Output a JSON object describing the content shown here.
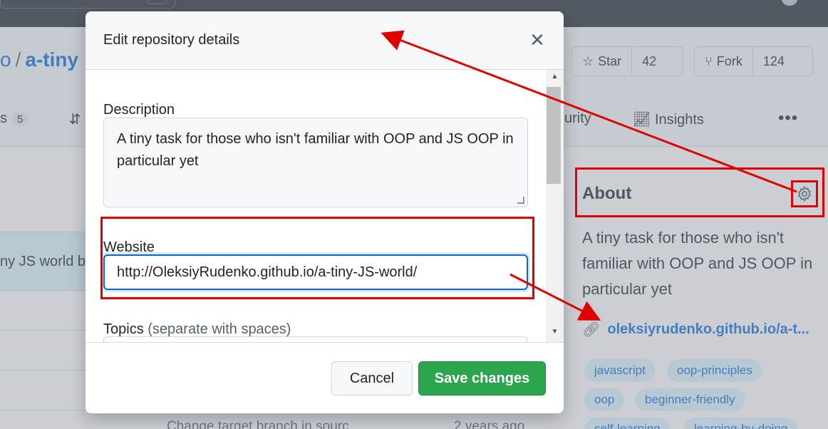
{
  "repo": {
    "owner": "o",
    "name": "a-tiny",
    "star_label": "Star",
    "star_count": "42",
    "fork_label": "Fork",
    "fork_count": "124"
  },
  "tabs": {
    "issues_suffix": "s",
    "issues_count": "5",
    "security_label": "urity",
    "insights_label": "Insights",
    "more_label": "•••"
  },
  "files": {
    "highlighted_row_text": "ny JS world b",
    "commit_snippet": "Change target branch in sourc",
    "ago_snippet": "2 years ago"
  },
  "about": {
    "title": "About",
    "description": "A tiny task for those who isn't familiar with OOP and JS OOP in particular yet",
    "link": "oleksiyrudenko.github.io/a-t...",
    "topics": [
      "javascript",
      "oop-principles",
      "oop",
      "beginner-friendly",
      "self-learning",
      "learning-by-doing"
    ]
  },
  "modal": {
    "title": "Edit repository details",
    "close_glyph": "✕",
    "description_label": "Description",
    "description_value": "A tiny task for those who isn't familiar with OOP and JS OOP in particular yet",
    "website_label": "Website",
    "website_value": "http://OleksiyRudenko.github.io/a-tiny-JS-world/",
    "topics_label": "Topics",
    "topics_hint": "(separate with spaces)",
    "cancel_label": "Cancel",
    "save_label": "Save changes"
  },
  "colors": {
    "annotation": "#e00000",
    "link": "#0969da",
    "save_green": "#2da44e"
  }
}
